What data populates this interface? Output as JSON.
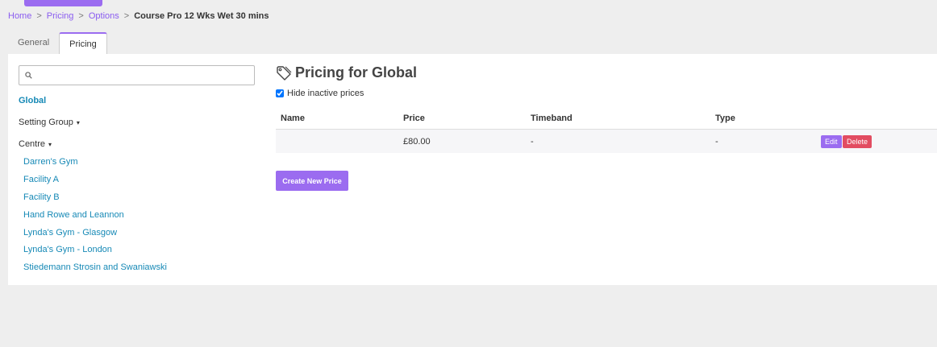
{
  "breadcrumb": {
    "items": [
      "Home",
      "Pricing",
      "Options"
    ],
    "separator": ">",
    "current": "Course Pro 12 Wks Wet 30 mins"
  },
  "tabs": [
    {
      "label": "General",
      "active": false
    },
    {
      "label": "Pricing",
      "active": true
    }
  ],
  "sidebar": {
    "search_placeholder": "",
    "global_label": "Global",
    "setting_group_label": "Setting Group",
    "centre_label": "Centre",
    "caret": "▾",
    "centres": [
      "Darren's Gym",
      "Facility A",
      "Facility B",
      "Hand Rowe and Leannon",
      "Lynda's Gym - Glasgow",
      "Lynda's Gym - London",
      "Stiedemann Strosin and Swaniawski"
    ]
  },
  "main": {
    "title": "Pricing for Global",
    "hide_inactive_label": "Hide inactive prices",
    "hide_inactive_checked": true,
    "columns": [
      "Name",
      "Price",
      "Timeband",
      "Type"
    ],
    "rows": [
      {
        "name": "",
        "price": "£80.00",
        "timeband": "-",
        "type": "-"
      }
    ],
    "edit_label": "Edit",
    "delete_label": "Delete",
    "create_label": "Create New Price"
  },
  "colors": {
    "accent": "#9b6cf0",
    "link": "#1689b6",
    "danger": "#e24c61"
  }
}
